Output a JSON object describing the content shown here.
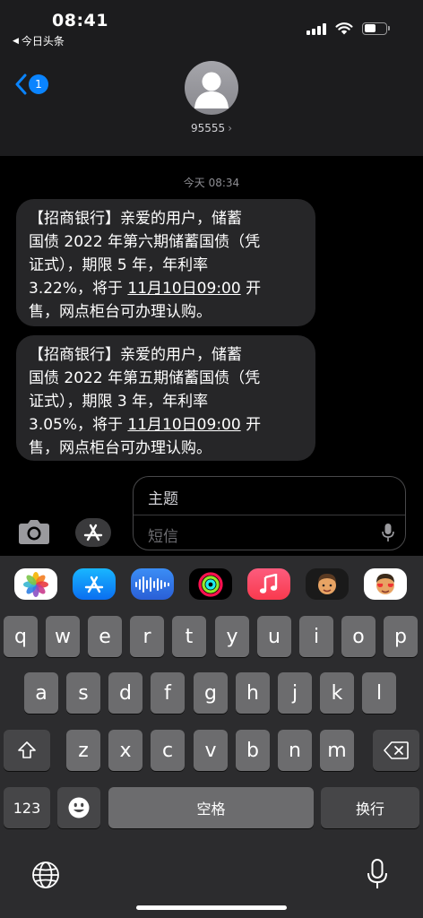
{
  "status_bar": {
    "time": "08:41",
    "back_app": "今日头条",
    "battery_level_fraction": 0.55
  },
  "header": {
    "back_badge": "1",
    "contact_name": "95555",
    "contact_chevron": "›"
  },
  "conversation": {
    "timestamp": "今天 08:34",
    "messages": [
      {
        "lines": [
          "【招商银行】亲爱的用户，储蓄",
          "国债 2022 年第六期储蓄国债（凭",
          "证式），期限 5 年，年利率"
        ],
        "line4_pre": "3.22%，将于 ",
        "line4_link": "11月10日09:00",
        "line4_post": " 开",
        "line5": "售，网点柜台可办理认购。"
      },
      {
        "lines": [
          "【招商银行】亲爱的用户，储蓄",
          "国债 2022 年第五期储蓄国债（凭",
          "证式），期限 3 年，年利率"
        ],
        "line4_pre": "3.05%，将于 ",
        "line4_link": "11月10日09:00",
        "line4_post": " 开",
        "line5": "售，网点柜台可办理认购。"
      }
    ]
  },
  "compose": {
    "subject_text": "主题",
    "message_placeholder": "短信"
  },
  "keyboard": {
    "row1": [
      "q",
      "w",
      "e",
      "r",
      "t",
      "y",
      "u",
      "i",
      "o",
      "p"
    ],
    "row2": [
      "a",
      "s",
      "d",
      "f",
      "g",
      "h",
      "j",
      "k",
      "l"
    ],
    "row3": [
      "z",
      "x",
      "c",
      "v",
      "b",
      "n",
      "m"
    ],
    "numbers_key": "123",
    "space_key": "空格",
    "return_key": "换行",
    "app_icons": [
      "photos-icon",
      "app-store-icon",
      "audio-message-icon",
      "activity-rings-icon",
      "music-icon",
      "memoji-icon",
      "memoji-stickers-icon"
    ]
  },
  "colors": {
    "accent": "#0a84ff",
    "bubble": "#262628",
    "key": "#6c6c6e",
    "key_dark": "#464648",
    "keyboard_bg": "#2c2c2e"
  }
}
